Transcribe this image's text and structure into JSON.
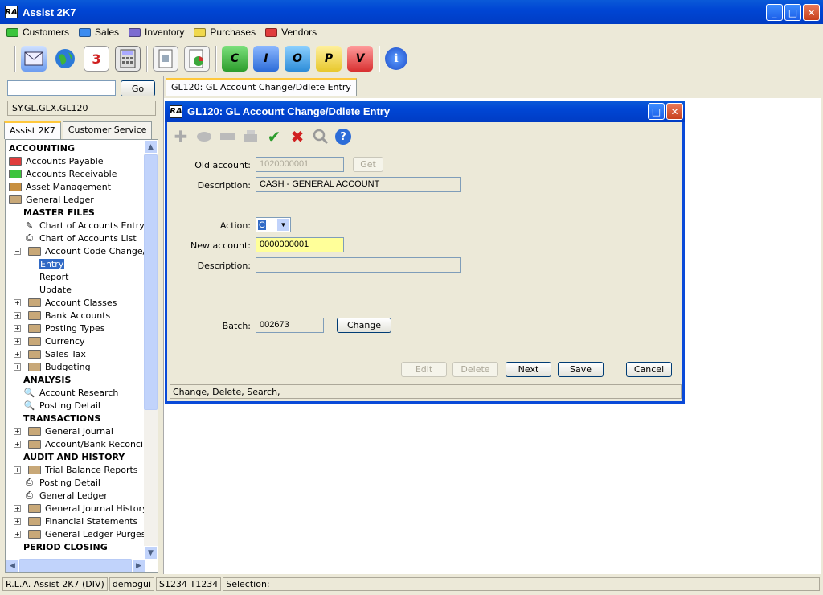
{
  "app": {
    "title": "Assist 2K7",
    "logo": "RA"
  },
  "window_controls": {
    "minimize": "_",
    "maximize": "□",
    "close": "✕"
  },
  "menu": [
    {
      "label": "Customers",
      "color": "#3cc43c"
    },
    {
      "label": "Sales",
      "color": "#3c8cf0"
    },
    {
      "label": "Inventory",
      "color": "#7c6cd0"
    },
    {
      "label": "Purchases",
      "color": "#f0d84c"
    },
    {
      "label": "Vendors",
      "color": "#e03c3c"
    }
  ],
  "toolbar": {
    "icons": [
      "mail-icon",
      "globe-icon",
      "calendar-icon",
      "calculator-icon",
      "report-icon",
      "chart-icon",
      "c-icon",
      "i-icon",
      "o-icon",
      "p-icon",
      "v-icon",
      "info-icon"
    ],
    "letters": {
      "calendar": "3",
      "c": "C",
      "i": "I",
      "o": "O",
      "p": "P",
      "v": "V",
      "info": "i"
    }
  },
  "search": {
    "value": "",
    "go_label": "Go"
  },
  "path": "SY.GL.GLX.GL120",
  "left_tabs": [
    "Assist 2K7",
    "Customer Service"
  ],
  "tree": [
    {
      "type": "header",
      "label": "ACCOUNTING",
      "indent": 0
    },
    {
      "type": "folder",
      "label": "Accounts Payable",
      "indent": 0,
      "color": "#e03c3c"
    },
    {
      "type": "folder",
      "label": "Accounts Receivable",
      "indent": 0,
      "color": "#3cc43c"
    },
    {
      "type": "folder",
      "label": "Asset Management",
      "indent": 0,
      "color": "#c89040"
    },
    {
      "type": "folder",
      "label": "General Ledger",
      "indent": 0,
      "color": "#c8a878"
    },
    {
      "type": "header",
      "label": "MASTER FILES",
      "indent": 1
    },
    {
      "type": "leaf",
      "label": "Chart of Accounts Entry",
      "indent": 1,
      "icon": "✎"
    },
    {
      "type": "leaf",
      "label": "Chart of Accounts List",
      "indent": 1,
      "icon": "⎙"
    },
    {
      "type": "expanded",
      "label": "Account Code Change/Dele",
      "indent": 1
    },
    {
      "type": "child",
      "label": "Entry",
      "indent": 2,
      "selected": true
    },
    {
      "type": "child",
      "label": "Report",
      "indent": 2
    },
    {
      "type": "child",
      "label": "Update",
      "indent": 2
    },
    {
      "type": "collapsed",
      "label": "Account Classes",
      "indent": 1
    },
    {
      "type": "collapsed",
      "label": "Bank Accounts",
      "indent": 1
    },
    {
      "type": "collapsed",
      "label": "Posting Types",
      "indent": 1
    },
    {
      "type": "collapsed",
      "label": "Currency",
      "indent": 1
    },
    {
      "type": "collapsed",
      "label": "Sales Tax",
      "indent": 1
    },
    {
      "type": "collapsed",
      "label": "Budgeting",
      "indent": 1
    },
    {
      "type": "header",
      "label": "ANALYSIS",
      "indent": 1
    },
    {
      "type": "leaf",
      "label": "Account Research",
      "indent": 1,
      "icon": "🔍"
    },
    {
      "type": "leaf",
      "label": "Posting Detail",
      "indent": 1,
      "icon": "🔍"
    },
    {
      "type": "header",
      "label": "TRANSACTIONS",
      "indent": 1
    },
    {
      "type": "collapsed",
      "label": "General Journal",
      "indent": 1
    },
    {
      "type": "collapsed",
      "label": "Account/Bank Reconciliatio",
      "indent": 1
    },
    {
      "type": "header",
      "label": "AUDIT AND HISTORY",
      "indent": 1
    },
    {
      "type": "collapsed",
      "label": "Trial Balance Reports",
      "indent": 1
    },
    {
      "type": "leaf",
      "label": "Posting Detail",
      "indent": 1,
      "icon": "⎙"
    },
    {
      "type": "leaf",
      "label": "General Ledger",
      "indent": 1,
      "icon": "⎙"
    },
    {
      "type": "collapsed",
      "label": "General Journal History",
      "indent": 1
    },
    {
      "type": "collapsed",
      "label": "Financial Statements",
      "indent": 1
    },
    {
      "type": "collapsed",
      "label": "General Ledger Purges",
      "indent": 1
    },
    {
      "type": "header",
      "label": "PERIOD CLOSING",
      "indent": 1
    }
  ],
  "main_tab": "GL120: GL Account Change/Ddlete Entry",
  "dialog": {
    "title": "GL120: GL Account Change/Ddlete Entry",
    "old_account_label": "Old account:",
    "old_account": "1020000001",
    "get_label": "Get",
    "description_label": "Description:",
    "description": "CASH - GENERAL ACCOUNT",
    "action_label": "Action:",
    "action": "C",
    "new_account_label": "New account:",
    "new_account": "0000000001",
    "new_description_label": "Description:",
    "new_description": "",
    "batch_label": "Batch:",
    "batch": "002673",
    "change_label": "Change",
    "buttons": {
      "edit": "Edit",
      "delete": "Delete",
      "next": "Next",
      "save": "Save",
      "cancel": "Cancel"
    },
    "status": "Change,  Delete,  Search,"
  },
  "statusbar": [
    "R.L.A. Assist 2K7 (DIV)",
    "demogui",
    "S1234 T1234",
    "Selection:"
  ]
}
